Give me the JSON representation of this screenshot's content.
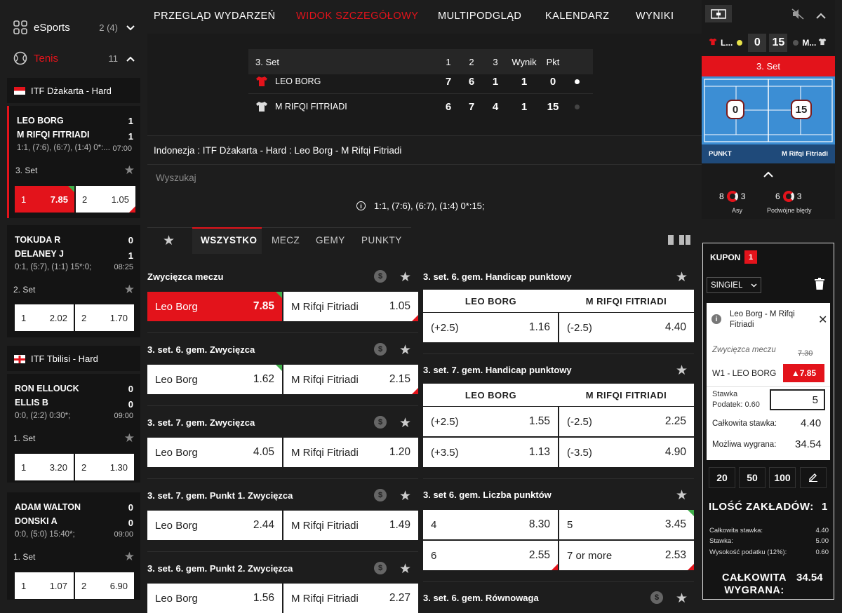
{
  "sidebar": {
    "esports": {
      "label": "eSports",
      "count": "2 (4)"
    },
    "tenis": {
      "label": "Tenis",
      "count": "11"
    },
    "leagues": [
      {
        "name": "ITF Dżakarta - Hard"
      },
      {
        "name": "ITF Tbilisi - Hard"
      }
    ],
    "matches": [
      {
        "p1": "LEO BORG",
        "s1": "1",
        "p2": "M RIFQI FITRIADI",
        "s2": "1",
        "detail": "1:1, (7:6), (6:7), (1:4) 0*:...",
        "time": "07:00",
        "set": "3. Set",
        "o1l": "1",
        "o1v": "7.85",
        "o2l": "2",
        "o2v": "1.05"
      },
      {
        "p1": "TOKUDA R",
        "s1": "0",
        "p2": "DELANEY J",
        "s2": "1",
        "detail": "0:1, (5:7), (1:1) 15*:0;",
        "time": "08:25",
        "set": "2. Set",
        "o1l": "1",
        "o1v": "2.02",
        "o2l": "2",
        "o2v": "1.70"
      },
      {
        "p1": "RON ELLOUCK",
        "s1": "0",
        "p2": "ELLIS B",
        "s2": "0",
        "detail": "0:0, (2:2) 0:30*;",
        "time": "09:00",
        "set": "1. Set",
        "o1l": "1",
        "o1v": "3.20",
        "o2l": "2",
        "o2v": "1.30"
      },
      {
        "p1": "ADAM WALTON",
        "s1": "0",
        "p2": "DONSKI A",
        "s2": "0",
        "detail": "0:0, (5:0) 15:40*;",
        "time": "09:00",
        "set": "1. Set",
        "o1l": "1",
        "o1v": "1.07",
        "o2l": "2",
        "o2v": "6.90"
      }
    ]
  },
  "nav": {
    "items": [
      "PRZEGLĄD WYDARZEŃ",
      "WIDOK SZCZEGÓŁOWY",
      "MULTIPODGLĄD",
      "KALENDARZ",
      "WYNIKI"
    ]
  },
  "scoreboard": {
    "set_label": "3. Set",
    "headers": [
      "1",
      "2",
      "3",
      "Wynik",
      "Pkt"
    ],
    "rows": [
      {
        "name": "LEO BORG",
        "cells": [
          "7",
          "6",
          "1",
          "1",
          "0"
        ]
      },
      {
        "name": "M RIFQI FITRIADI",
        "cells": [
          "6",
          "7",
          "4",
          "1",
          "15"
        ]
      }
    ]
  },
  "event": {
    "breadcrumb": "Indonezja : ITF Dżakarta - Hard : Leo Borg - M Rifqi Fitriadi",
    "search_placeholder": "Wyszukaj",
    "score_line": "1:1, (7:6), (6:7), (1:4) 0*:15;"
  },
  "market_tabs": [
    "WSZYSTKO",
    "MECZ",
    "GEMY",
    "PUNKTY"
  ],
  "markets_left": [
    {
      "title": "Zwycięzca meczu",
      "a": "Leo Borg",
      "av": "7.85",
      "b": "M Rifqi Fitriadi",
      "bv": "1.05"
    },
    {
      "title": "3. set. 6. gem. Zwycięzca",
      "a": "Leo Borg",
      "av": "1.62",
      "b": "M Rifqi Fitriadi",
      "bv": "2.15"
    },
    {
      "title": "3. set. 7. gem. Zwycięzca",
      "a": "Leo Borg",
      "av": "4.05",
      "b": "M Rifqi Fitriadi",
      "bv": "1.20"
    },
    {
      "title": "3. set. 7. gem. Punkt 1. Zwycięzca",
      "a": "Leo Borg",
      "av": "2.44",
      "b": "M Rifqi Fitriadi",
      "bv": "1.49"
    },
    {
      "title": "3. set. 6. gem. Punkt 2. Zwycięzca",
      "a": "Leo Borg",
      "av": "1.56",
      "b": "M Rifqi Fitriadi",
      "bv": "2.27"
    }
  ],
  "markets_right": {
    "m1": {
      "title": "3. set. 6. gem. Handicap punktowy",
      "h1": "LEO BORG",
      "h2": "M RIFQI FITRIADI",
      "r1a": "(+2.5)",
      "r1av": "1.16",
      "r1b": "(-2.5)",
      "r1bv": "4.40"
    },
    "m2": {
      "title": "3. set. 7. gem. Handicap punktowy",
      "h1": "LEO BORG",
      "h2": "M RIFQI FITRIADI",
      "r1a": "(+2.5)",
      "r1av": "1.55",
      "r1b": "(-2.5)",
      "r1bv": "2.25",
      "r2a": "(+3.5)",
      "r2av": "1.13",
      "r2b": "(-3.5)",
      "r2bv": "4.90"
    },
    "m3": {
      "title": "3. set 6. gem. Liczba punktów",
      "r1a": "4",
      "r1av": "8.30",
      "r1b": "5",
      "r1bv": "3.45",
      "r2a": "6",
      "r2av": "2.55",
      "r2b": "7 or more",
      "r2bv": "2.53"
    },
    "m4": {
      "title": "3. set. 6. gem. Równowaga"
    }
  },
  "live": {
    "p1": "L...",
    "p2": "M...",
    "s1": "0",
    "s2": "15",
    "set": "3. Set",
    "court_s1": "0",
    "court_s2": "15",
    "punkt": "PUNKT",
    "punkt_player": "M Rifqi Fitriadi",
    "aces_l": "8",
    "aces_r": "3",
    "aces_label": "Asy",
    "df_l": "6",
    "df_r": "3",
    "df_label": "Podwójne błędy"
  },
  "coupon": {
    "title": "KUPON",
    "badge": "1",
    "type": "SINGIEL",
    "event": "Leo Borg - M Rifqi Fitriadi",
    "market": "Zwycięzca meczu",
    "old_odds": "7.30",
    "selection": "W1 - LEO BORG",
    "odds": "▲7.85",
    "stake_label": "Stawka",
    "tax_label": "Podatek: 0.60",
    "stake_value": "5",
    "total_label": "Całkowita stawka:",
    "total_value": "4.40",
    "win_label": "Możliwa wygrana:",
    "win_value": "34.54",
    "quick": [
      "20",
      "50",
      "100"
    ],
    "count_label": "ILOŚĆ ZAKŁADÓW:",
    "count_value": "1",
    "sum": [
      {
        "l": "Całkowita stawka:",
        "v": "4.40"
      },
      {
        "l": "Stawka:",
        "v": "5.00"
      },
      {
        "l": "Wysokość podatku (12%):",
        "v": "0.60"
      }
    ],
    "final_label": "CAŁKOWITA WYGRANA:",
    "final_value": "34.54"
  }
}
